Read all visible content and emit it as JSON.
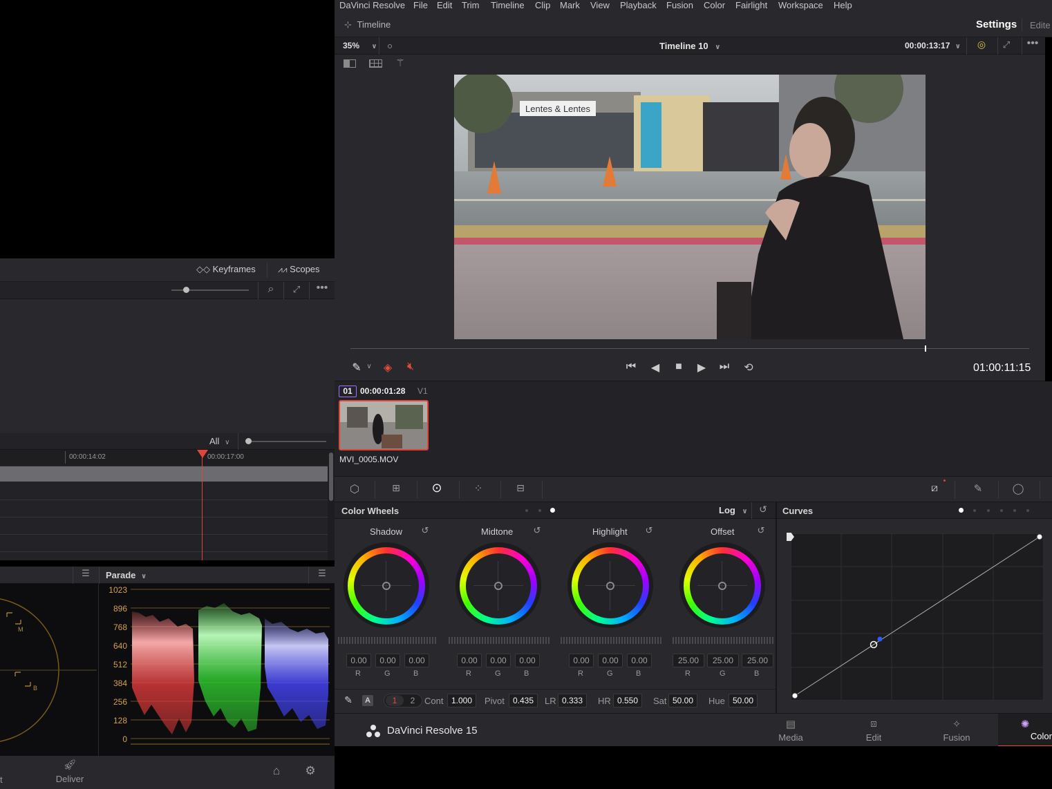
{
  "left": {
    "keyframes_label": "Keyframes",
    "scopes_label": "Scopes",
    "filter_all": "All",
    "ruler": [
      "00:00:14:02",
      "00:00:17:00"
    ],
    "scope_type": "Parade",
    "parade_ticks": [
      "1023",
      "896",
      "768",
      "640",
      "512",
      "384",
      "256",
      "128",
      "0"
    ],
    "deliver_label": "Deliver",
    "vectorscope_marks": [
      "M",
      "B"
    ]
  },
  "menubar": {
    "items": [
      "DaVinci Resolve",
      "File",
      "Edit",
      "Trim",
      "Timeline",
      "Clip",
      "Mark",
      "View",
      "Playback",
      "Fusion",
      "Color",
      "Fairlight",
      "Workspace",
      "Help"
    ]
  },
  "tlbar": {
    "timeline_label": "Timeline",
    "settings_label": "Settings",
    "edited_label": "Edite"
  },
  "viewer": {
    "zoom": "35%",
    "timeline_name": "Timeline 10",
    "timecode_top": "00:00:13:17",
    "timecode": "01:00:11:15",
    "image_sign": "Lentes & Lentes"
  },
  "clip": {
    "index": "01",
    "timecode": "00:00:01:28",
    "track": "V1",
    "name": "MVI_0005.MOV"
  },
  "color_wheels": {
    "title": "Color Wheels",
    "mode": "Log",
    "wheels": [
      {
        "name": "Shadow",
        "r": "0.00",
        "g": "0.00",
        "b": "0.00"
      },
      {
        "name": "Midtone",
        "r": "0.00",
        "g": "0.00",
        "b": "0.00"
      },
      {
        "name": "Highlight",
        "r": "0.00",
        "g": "0.00",
        "b": "0.00"
      },
      {
        "name": "Offset",
        "r": "25.00",
        "g": "25.00",
        "b": "25.00"
      }
    ],
    "channel_labels": {
      "r": "R",
      "g": "G",
      "b": "B"
    },
    "auto_label": "A",
    "page1": "1",
    "page2": "2",
    "params": [
      {
        "label": "Cont",
        "value": "1.000"
      },
      {
        "label": "Pivot",
        "value": "0.435"
      },
      {
        "label": "LR",
        "value": "0.333"
      },
      {
        "label": "HR",
        "value": "0.550"
      },
      {
        "label": "Sat",
        "value": "50.00"
      },
      {
        "label": "Hue",
        "value": "50.00"
      }
    ]
  },
  "curves": {
    "title": "Curves"
  },
  "bottom_nav": {
    "app_name": "DaVinci Resolve 15",
    "items": [
      "Media",
      "Edit",
      "Fusion",
      "Color"
    ]
  },
  "colors": {
    "accent": "#e64b3c",
    "panel": "#28282d",
    "panel_dark": "#232327"
  }
}
